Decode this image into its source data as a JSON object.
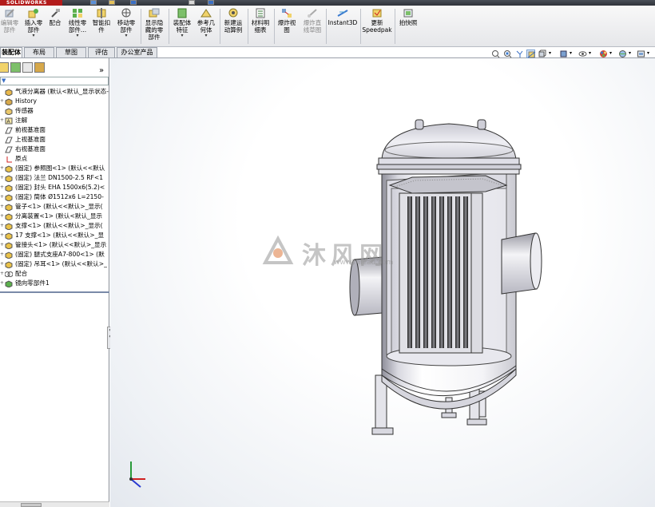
{
  "app": {
    "logo_text": "SOLIDWORKS"
  },
  "ribbon": {
    "buttons": [
      {
        "id": "edit-component",
        "label": "编辑零\n部件",
        "dim": true
      },
      {
        "id": "insert-component",
        "label": "插入零\n部件",
        "dropdown": true
      },
      {
        "id": "mate",
        "label": "配合"
      },
      {
        "id": "linear-pattern",
        "label": "线性零\n部件...",
        "dropdown": true
      },
      {
        "id": "smart-fasteners",
        "label": "智能扣\n件"
      },
      {
        "id": "move-component",
        "label": "移动零\n部件",
        "dropdown": true
      },
      {
        "id": "show-hidden",
        "label": "显示隐\n藏的零\n部件"
      },
      {
        "id": "assembly-features",
        "label": "装配体\n特征",
        "dropdown": true
      },
      {
        "id": "reference-geometry",
        "label": "参考几\n何体",
        "dropdown": true
      },
      {
        "id": "new-motion-study",
        "label": "新建运\n动算例"
      },
      {
        "id": "bill-of-materials",
        "label": "材料明\n细表"
      },
      {
        "id": "exploded-view",
        "label": "爆炸视\n图"
      },
      {
        "id": "explode-line-sketch",
        "label": "爆炸直\n线草图",
        "dim": true
      },
      {
        "id": "instant3d",
        "label": "Instant3D"
      },
      {
        "id": "update-speedpak",
        "label": "更新\nSpeedpak"
      },
      {
        "id": "take-snapshot",
        "label": "拍快照"
      }
    ]
  },
  "tabs": [
    {
      "label": "装配体",
      "active": true
    },
    {
      "label": "布局"
    },
    {
      "label": "草图"
    },
    {
      "label": "评估"
    },
    {
      "label": "办公室产品"
    }
  ],
  "panel": {
    "more": "»",
    "filter": "▼"
  },
  "tree": [
    {
      "text": "气液分离器 (默认<默认_显示状态-",
      "icon": "assembly-icon"
    },
    {
      "text": "History",
      "icon": "history-icon",
      "exp": "+"
    },
    {
      "text": "传感器",
      "icon": "sensor-icon"
    },
    {
      "text": "注解",
      "icon": "annotation-icon",
      "exp": "+"
    },
    {
      "text": "前视基准面",
      "icon": "plane-icon"
    },
    {
      "text": "上视基准面",
      "icon": "plane-icon"
    },
    {
      "text": "右视基准面",
      "icon": "plane-icon"
    },
    {
      "text": "原点",
      "icon": "origin-icon"
    },
    {
      "text": "(固定) 参照图<1> (默认<<默认",
      "icon": "part-icon",
      "exp": "+"
    },
    {
      "text": "(固定) 法兰 DN1500-2.5 RF<1",
      "icon": "part-icon",
      "exp": "+"
    },
    {
      "text": "(固定) 封头 EHA 1500x6(5.2)<",
      "icon": "part-icon",
      "exp": "+"
    },
    {
      "text": "(固定) 筒体 Ø1512x6 L=2150-",
      "icon": "part-icon",
      "exp": "+"
    },
    {
      "text": "管子<1> (默认<<默认>_显示(",
      "icon": "part-icon",
      "exp": "+"
    },
    {
      "text": "分离装置<1> (默认<默认_显示",
      "icon": "part-icon",
      "exp": "+"
    },
    {
      "text": "支撑<1> (默认<<默认>_显示(",
      "icon": "part-icon",
      "exp": "+"
    },
    {
      "text": "17 支撑<1> (默认<<默认>_显",
      "icon": "part-icon",
      "exp": "+"
    },
    {
      "text": "管接头<1> (默认<<默认>_显示",
      "icon": "part-icon",
      "exp": "+"
    },
    {
      "text": "(固定) 腿式支座A7-800<1> (默",
      "icon": "part-icon",
      "exp": "+"
    },
    {
      "text": "(固定) 吊耳<1> (默认<<默认>_",
      "icon": "part-icon",
      "exp": "+"
    },
    {
      "text": "配合",
      "icon": "mates-icon",
      "exp": "+"
    },
    {
      "text": "镜向零部件1",
      "icon": "mirror-icon",
      "exp": "+"
    }
  ],
  "watermark": {
    "text": "沐风网",
    "url": "www.mfcad.com"
  },
  "colors": {
    "accent": "#b31b1b",
    "selection": "#d7e6f7",
    "tree_border": "#7a8aa8"
  }
}
